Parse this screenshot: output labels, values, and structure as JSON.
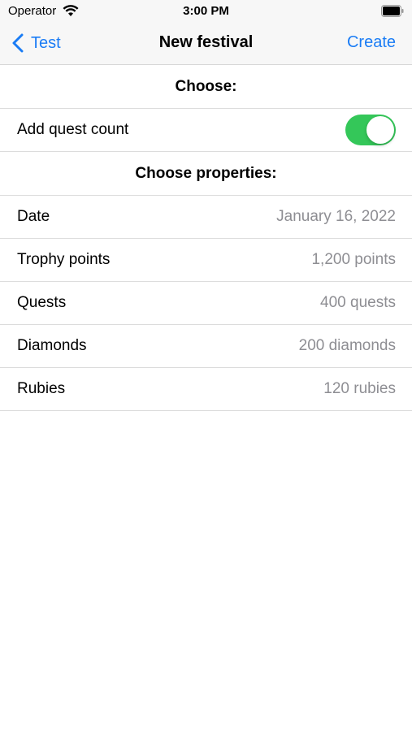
{
  "status_bar": {
    "carrier": "Operator",
    "time": "3:00 PM"
  },
  "nav": {
    "back_label": "Test",
    "title": "New festival",
    "action_label": "Create"
  },
  "sections": {
    "choose_header": "Choose:",
    "toggle_row_label": "Add quest count",
    "toggle_on": true,
    "properties_header": "Choose properties:"
  },
  "properties": [
    {
      "label": "Date",
      "value": "January 16, 2022"
    },
    {
      "label": "Trophy points",
      "value": "1,200 points"
    },
    {
      "label": "Quests",
      "value": "400 quests"
    },
    {
      "label": "Diamonds",
      "value": "200 diamonds"
    },
    {
      "label": "Rubies",
      "value": "120 rubies"
    }
  ],
  "colors": {
    "accent": "#1a7cf5",
    "toggle_on": "#34c759",
    "secondary_text": "#8e8e93"
  }
}
